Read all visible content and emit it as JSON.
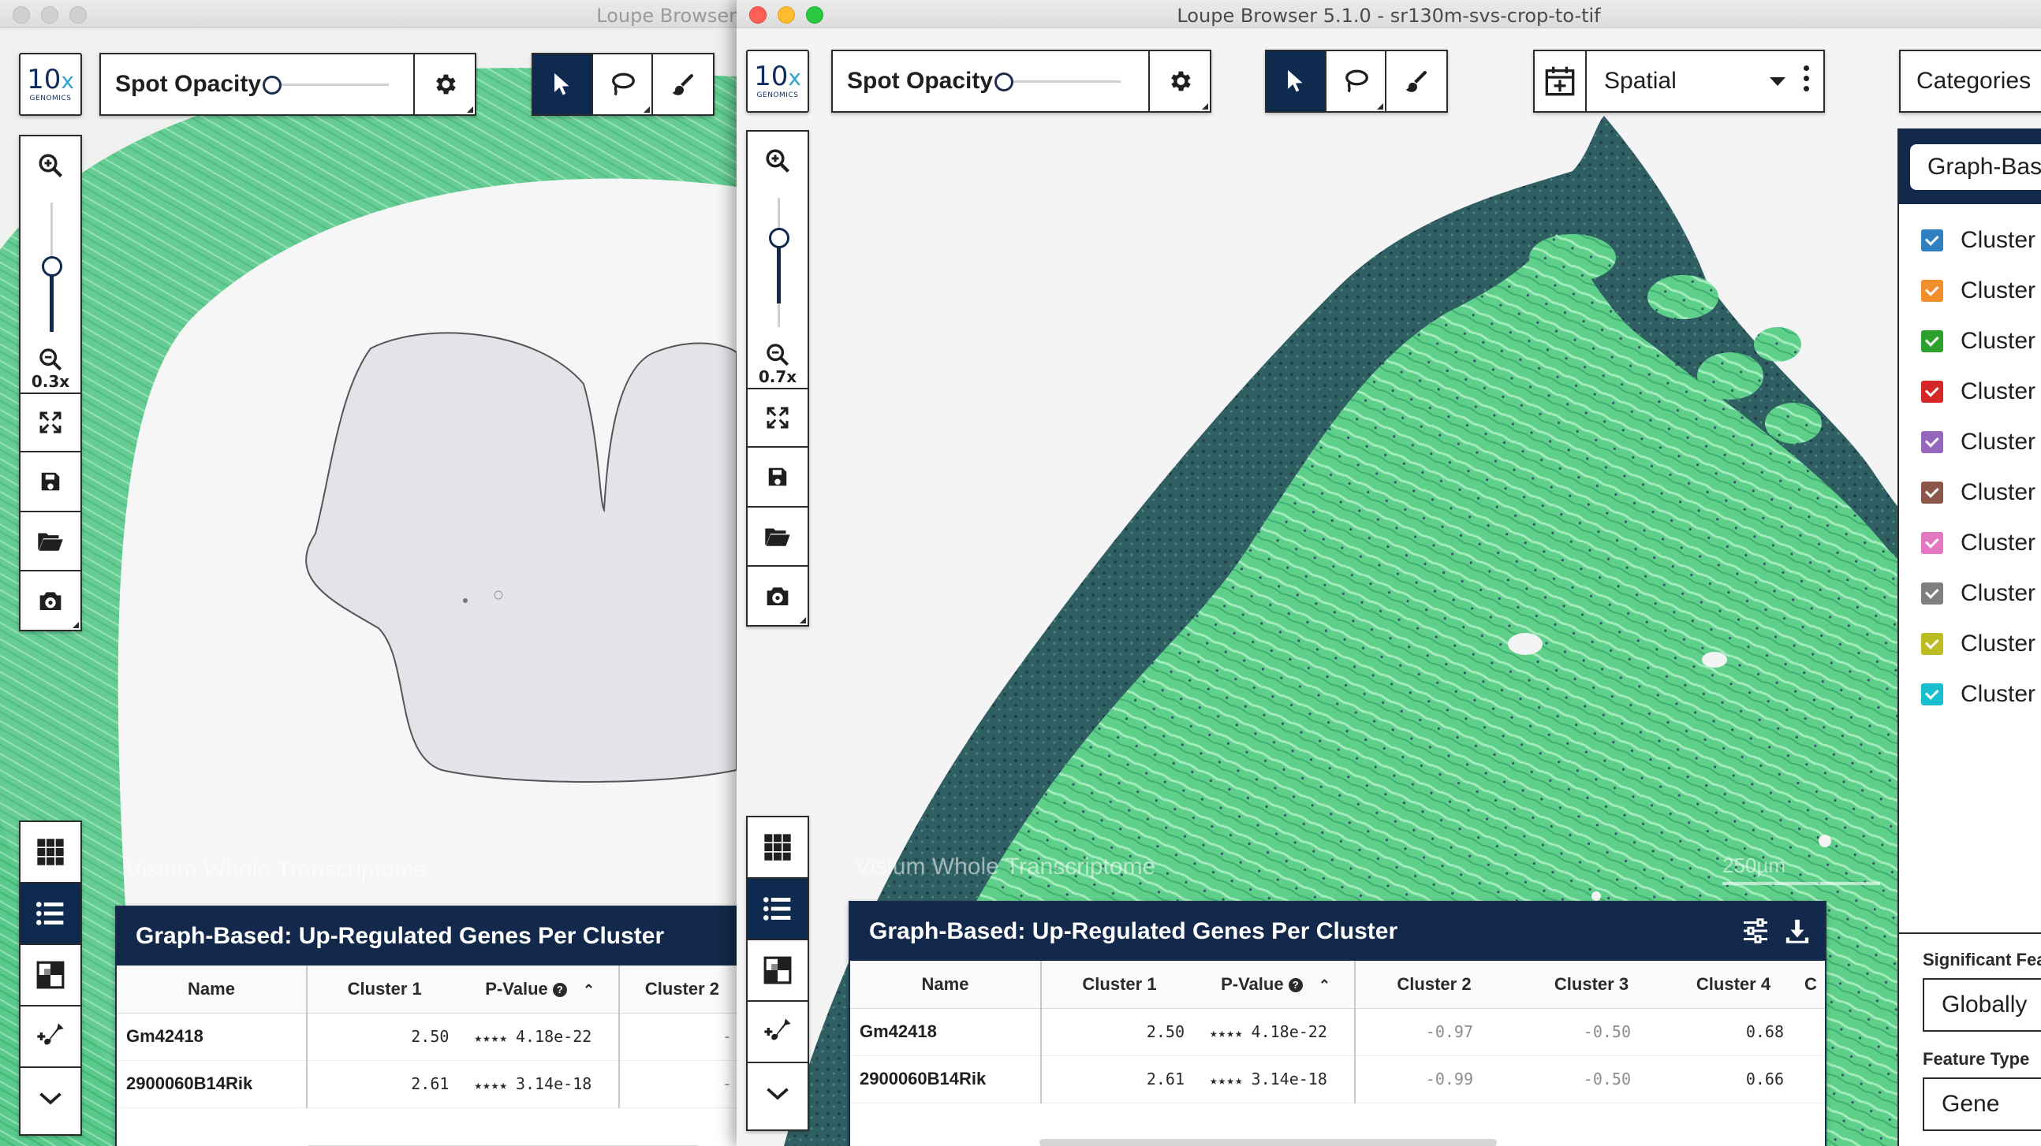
{
  "back_window": {
    "title": "Loupe Browser",
    "spot_opacity_label": "Spot Opacity",
    "zoom_label": "0.3x",
    "watermark": "Visium Whole Transcriptome",
    "table": {
      "title": "Graph-Based: Up-Regulated Genes Per Cluster",
      "columns": [
        "Name",
        "Cluster 1",
        "P-Value",
        "Cluster 2"
      ],
      "rows": [
        {
          "name": "Gm42418",
          "cluster1": "2.50",
          "stars": "★★★★",
          "pvalue": "4.18e-22",
          "cluster2": "-"
        },
        {
          "name": "2900060B14Rik",
          "cluster1": "2.61",
          "stars": "★★★★",
          "pvalue": "3.14e-18",
          "cluster2": "-"
        }
      ]
    }
  },
  "front_window": {
    "title": "Loupe Browser 5.1.0 - sr130m-svs-crop-to-tif",
    "spot_opacity_label": "Spot Opacity",
    "zoom_label": "0.7x",
    "view_selector": "Spatial",
    "categories_button": "Categories",
    "watermark": "Visium Whole Transcriptome",
    "scale_label": "250µm",
    "table": {
      "title": "Graph-Based: Up-Regulated Genes Per Cluster",
      "columns": [
        "Name",
        "Cluster 1",
        "P-Value",
        "Cluster 2",
        "Cluster 3",
        "Cluster 4",
        "C"
      ],
      "rows": [
        {
          "name": "Gm42418",
          "cluster1": "2.50",
          "stars": "★★★★",
          "pvalue": "4.18e-22",
          "cluster2": "-0.97",
          "cluster3": "-0.50",
          "cluster4": "0.68"
        },
        {
          "name": "2900060B14Rik",
          "cluster1": "2.61",
          "stars": "★★★★",
          "pvalue": "3.14e-18",
          "cluster2": "-0.99",
          "cluster3": "-0.50",
          "cluster4": "0.66"
        }
      ]
    },
    "right_panel": {
      "category_selector": "Graph-Bas",
      "clusters": [
        {
          "label": "Cluster",
          "color": "#2f7fc1"
        },
        {
          "label": "Cluster",
          "color": "#f28e2b"
        },
        {
          "label": "Cluster",
          "color": "#2ca02c"
        },
        {
          "label": "Cluster",
          "color": "#d62728"
        },
        {
          "label": "Cluster",
          "color": "#9467bd"
        },
        {
          "label": "Cluster",
          "color": "#8c564b"
        },
        {
          "label": "Cluster",
          "color": "#e377c2"
        },
        {
          "label": "Cluster",
          "color": "#7f7f7f"
        },
        {
          "label": "Cluster",
          "color": "#bcbd22"
        },
        {
          "label": "Cluster",
          "color": "#17becf"
        }
      ],
      "significant_label": "Significant Fea",
      "significant_value": "Globally",
      "feature_type_label": "Feature Type",
      "feature_type_value": "Gene"
    }
  },
  "logo": {
    "big": "10",
    "x": "x",
    "small": "GENOMICS"
  },
  "colors": {
    "accent_navy": "#13294b",
    "tissue_green": "#5fd08a",
    "tissue_dark": "#2e5a5c"
  }
}
